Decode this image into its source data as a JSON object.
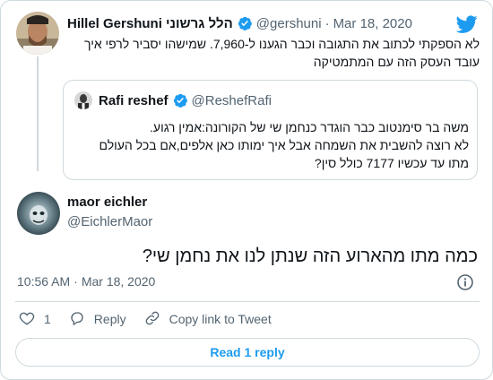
{
  "parent": {
    "name": "Hillel Gershuni הלל גרשוני",
    "handle": "@gershuni",
    "separator": "·",
    "date": "Mar 18, 2020",
    "text": "לא הספקתי לכתוב את התגובה וכבר הגענו ל-7,960. שמישהו יסביר לרפי איך עובד העסק הזה עם המתמטיקה"
  },
  "quote": {
    "name": "Rafi reshef",
    "handle": "@ReshefRafi",
    "lines": [
      "משה בר סימנטוב כבר הוגדר כנחמן שי של הקורונה:אמין רגוע.",
      "לא רוצה להשבית את השמחה אבל איך ימותו כאן  אלפים,אם בכל העולם",
      "מתו  עד עכשיו 7177 כולל סין?"
    ]
  },
  "reply": {
    "name": "maor eichler",
    "handle": "@EichlerMaor",
    "text": "כמה מתו מהארוע הזה שנתן לנו את נחמן שי?",
    "time": "10:56 AM",
    "separator": "·",
    "date": "Mar 18, 2020"
  },
  "actions": {
    "like_count": "1",
    "reply_label": "Reply",
    "copy_label": "Copy link to Tweet"
  },
  "read_replies_label": "Read 1 reply",
  "colors": {
    "accent": "#1d9bf0",
    "muted": "#536471",
    "border": "#cfd9de"
  }
}
